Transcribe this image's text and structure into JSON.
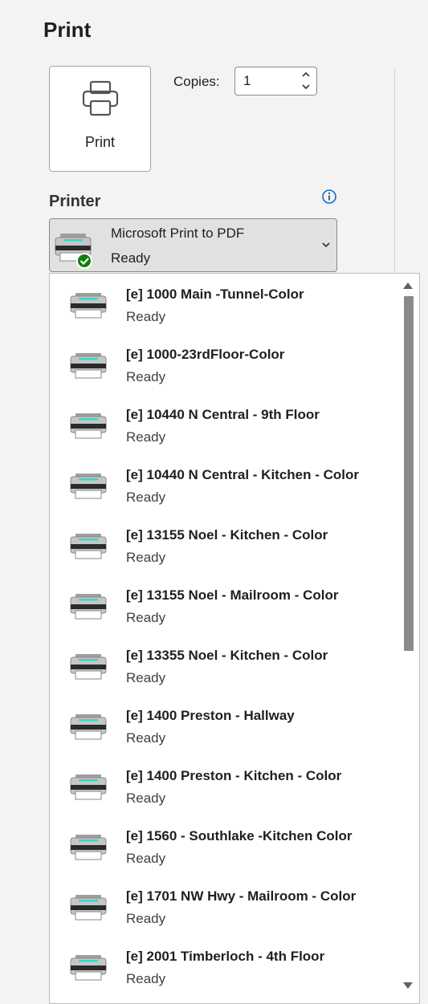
{
  "page": {
    "title": "Print"
  },
  "print_button": {
    "label": "Print",
    "icon": "printer-icon"
  },
  "copies": {
    "label": "Copies:",
    "value": "1"
  },
  "printer": {
    "label": "Printer",
    "selected": {
      "name": "Microsoft Print to PDF",
      "status": "Ready",
      "icon": "printer-ready-icon"
    }
  },
  "printer_list": [
    {
      "name": "[e] 1000 Main -Tunnel-Color",
      "status": "Ready"
    },
    {
      "name": "[e] 1000-23rdFloor-Color",
      "status": "Ready"
    },
    {
      "name": "[e] 10440 N Central - 9th Floor",
      "status": "Ready"
    },
    {
      "name": "[e] 10440 N Central - Kitchen - Color",
      "status": "Ready"
    },
    {
      "name": "[e] 13155 Noel - Kitchen - Color",
      "status": "Ready"
    },
    {
      "name": "[e] 13155 Noel - Mailroom - Color",
      "status": "Ready"
    },
    {
      "name": "[e] 13355 Noel - Kitchen - Color",
      "status": "Ready"
    },
    {
      "name": "[e] 1400 Preston - Hallway",
      "status": "Ready"
    },
    {
      "name": "[e] 1400 Preston - Kitchen - Color",
      "status": "Ready"
    },
    {
      "name": "[e] 1560 - Southlake -Kitchen Color",
      "status": "Ready"
    },
    {
      "name": "[e] 1701 NW Hwy - Mailroom - Color",
      "status": "Ready"
    },
    {
      "name": "[e] 2001 Timberloch - 4th Floor",
      "status": "Ready"
    }
  ],
  "colors": {
    "ready_badge": "#107c10",
    "info_icon": "#0f6cbd",
    "printer_led": "#3ad6c4"
  }
}
